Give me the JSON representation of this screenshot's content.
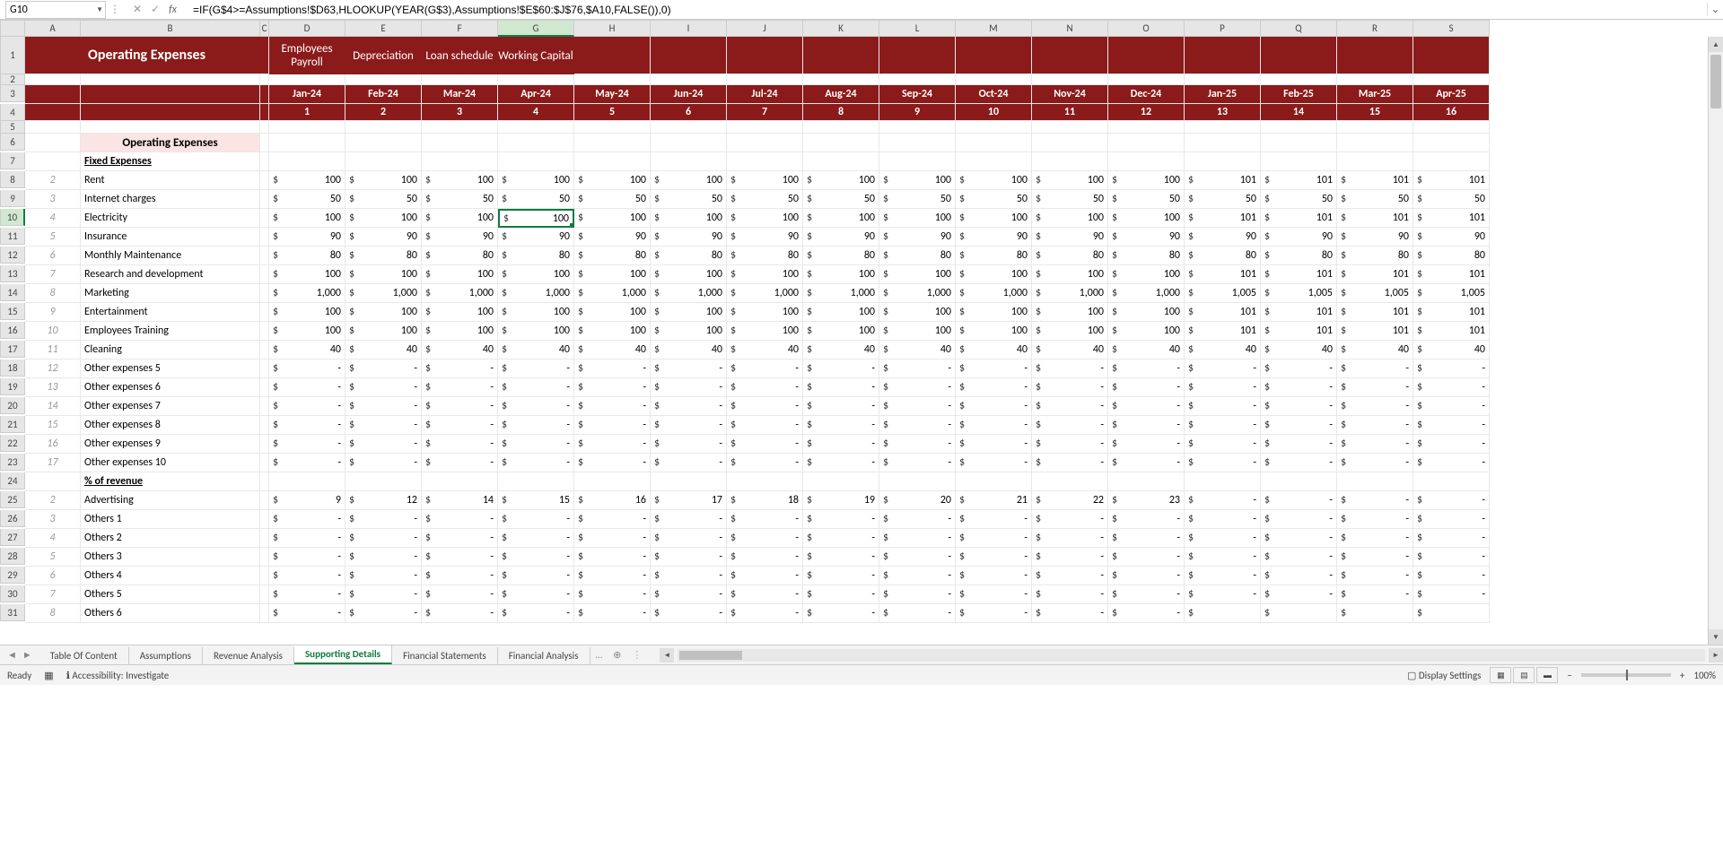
{
  "name_box": "G10",
  "formula": "=IF(G$4>=Assumptions!$D63,HLOOKUP(YEAR(G$3),Assumptions!$E$60:$J$76,$A10,FALSE()),0)",
  "title": "Operating Expenses",
  "top_tabs": {
    "D": "Employees Payroll",
    "E": "Depreciation",
    "F": "Loan schedule",
    "G": "Working Capital"
  },
  "columns": [
    "A",
    "B",
    "C",
    "D",
    "E",
    "F",
    "G",
    "H",
    "I",
    "J",
    "K",
    "L",
    "M",
    "N",
    "O",
    "P",
    "Q",
    "R",
    "S"
  ],
  "months": [
    "Jan-24",
    "Feb-24",
    "Mar-24",
    "Apr-24",
    "May-24",
    "Jun-24",
    "Jul-24",
    "Aug-24",
    "Sep-24",
    "Oct-24",
    "Nov-24",
    "Dec-24",
    "Jan-25",
    "Feb-25",
    "Mar-25",
    "Apr-25"
  ],
  "month_idx": [
    "1",
    "2",
    "3",
    "4",
    "5",
    "6",
    "7",
    "8",
    "9",
    "10",
    "11",
    "12",
    "13",
    "14",
    "15",
    "16"
  ],
  "section_header": "Operating Expenses",
  "fixed_header": "Fixed Expenses",
  "pct_header": "% of revenue",
  "fixed_rows": [
    {
      "idx": "2",
      "label": "Rent",
      "vals": [
        "100",
        "100",
        "100",
        "100",
        "100",
        "100",
        "100",
        "100",
        "100",
        "100",
        "100",
        "100",
        "101",
        "101",
        "101",
        "101"
      ]
    },
    {
      "idx": "3",
      "label": "Internet charges",
      "vals": [
        "50",
        "50",
        "50",
        "50",
        "50",
        "50",
        "50",
        "50",
        "50",
        "50",
        "50",
        "50",
        "50",
        "50",
        "50",
        "50"
      ]
    },
    {
      "idx": "4",
      "label": "Electricity",
      "vals": [
        "100",
        "100",
        "100",
        "100",
        "100",
        "100",
        "100",
        "100",
        "100",
        "100",
        "100",
        "100",
        "101",
        "101",
        "101",
        "101"
      ]
    },
    {
      "idx": "5",
      "label": "Insurance",
      "vals": [
        "90",
        "90",
        "90",
        "90",
        "90",
        "90",
        "90",
        "90",
        "90",
        "90",
        "90",
        "90",
        "90",
        "90",
        "90",
        "90"
      ]
    },
    {
      "idx": "6",
      "label": "Monthly Maintenance",
      "vals": [
        "80",
        "80",
        "80",
        "80",
        "80",
        "80",
        "80",
        "80",
        "80",
        "80",
        "80",
        "80",
        "80",
        "80",
        "80",
        "80"
      ]
    },
    {
      "idx": "7",
      "label": "Research and development",
      "vals": [
        "100",
        "100",
        "100",
        "100",
        "100",
        "100",
        "100",
        "100",
        "100",
        "100",
        "100",
        "100",
        "101",
        "101",
        "101",
        "101"
      ]
    },
    {
      "idx": "8",
      "label": "Marketing",
      "vals": [
        "1,000",
        "1,000",
        "1,000",
        "1,000",
        "1,000",
        "1,000",
        "1,000",
        "1,000",
        "1,000",
        "1,000",
        "1,000",
        "1,000",
        "1,005",
        "1,005",
        "1,005",
        "1,005"
      ]
    },
    {
      "idx": "9",
      "label": "Entertainment",
      "vals": [
        "100",
        "100",
        "100",
        "100",
        "100",
        "100",
        "100",
        "100",
        "100",
        "100",
        "100",
        "100",
        "101",
        "101",
        "101",
        "101"
      ]
    },
    {
      "idx": "10",
      "label": "Employees Training",
      "vals": [
        "100",
        "100",
        "100",
        "100",
        "100",
        "100",
        "100",
        "100",
        "100",
        "100",
        "100",
        "100",
        "101",
        "101",
        "101",
        "101"
      ]
    },
    {
      "idx": "11",
      "label": "Cleaning",
      "vals": [
        "40",
        "40",
        "40",
        "40",
        "40",
        "40",
        "40",
        "40",
        "40",
        "40",
        "40",
        "40",
        "40",
        "40",
        "40",
        "40"
      ]
    },
    {
      "idx": "12",
      "label": "Other expenses 5",
      "vals": [
        "-",
        "-",
        "-",
        "-",
        "-",
        "-",
        "-",
        "-",
        "-",
        "-",
        "-",
        "-",
        "-",
        "-",
        "-",
        "-"
      ]
    },
    {
      "idx": "13",
      "label": "Other expenses 6",
      "vals": [
        "-",
        "-",
        "-",
        "-",
        "-",
        "-",
        "-",
        "-",
        "-",
        "-",
        "-",
        "-",
        "-",
        "-",
        "-",
        "-"
      ]
    },
    {
      "idx": "14",
      "label": "Other expenses 7",
      "vals": [
        "-",
        "-",
        "-",
        "-",
        "-",
        "-",
        "-",
        "-",
        "-",
        "-",
        "-",
        "-",
        "-",
        "-",
        "-",
        "-"
      ]
    },
    {
      "idx": "15",
      "label": "Other expenses 8",
      "vals": [
        "-",
        "-",
        "-",
        "-",
        "-",
        "-",
        "-",
        "-",
        "-",
        "-",
        "-",
        "-",
        "-",
        "-",
        "-",
        "-"
      ]
    },
    {
      "idx": "16",
      "label": "Other expenses 9",
      "vals": [
        "-",
        "-",
        "-",
        "-",
        "-",
        "-",
        "-",
        "-",
        "-",
        "-",
        "-",
        "-",
        "-",
        "-",
        "-",
        "-"
      ]
    },
    {
      "idx": "17",
      "label": "Other expenses 10",
      "vals": [
        "-",
        "-",
        "-",
        "-",
        "-",
        "-",
        "-",
        "-",
        "-",
        "-",
        "-",
        "-",
        "-",
        "-",
        "-",
        "-"
      ]
    }
  ],
  "pct_rows": [
    {
      "idx": "2",
      "label": "Advertising",
      "vals": [
        "9",
        "12",
        "14",
        "15",
        "16",
        "17",
        "18",
        "19",
        "20",
        "21",
        "22",
        "23",
        "-",
        "-",
        "-",
        "-"
      ]
    },
    {
      "idx": "3",
      "label": "Others 1",
      "vals": [
        "-",
        "-",
        "-",
        "-",
        "-",
        "-",
        "-",
        "-",
        "-",
        "-",
        "-",
        "-",
        "-",
        "-",
        "-",
        "-"
      ]
    },
    {
      "idx": "4",
      "label": "Others 2",
      "vals": [
        "-",
        "-",
        "-",
        "-",
        "-",
        "-",
        "-",
        "-",
        "-",
        "-",
        "-",
        "-",
        "-",
        "-",
        "-",
        "-"
      ]
    },
    {
      "idx": "5",
      "label": "Others 3",
      "vals": [
        "-",
        "-",
        "-",
        "-",
        "-",
        "-",
        "-",
        "-",
        "-",
        "-",
        "-",
        "-",
        "-",
        "-",
        "-",
        "-"
      ]
    },
    {
      "idx": "6",
      "label": "Others 4",
      "vals": [
        "-",
        "-",
        "-",
        "-",
        "-",
        "-",
        "-",
        "-",
        "-",
        "-",
        "-",
        "-",
        "-",
        "-",
        "-",
        "-"
      ]
    },
    {
      "idx": "7",
      "label": "Others 5",
      "vals": [
        "-",
        "-",
        "-",
        "-",
        "-",
        "-",
        "-",
        "-",
        "-",
        "-",
        "-",
        "-",
        "-",
        "-",
        "-",
        "-"
      ]
    },
    {
      "idx": "8",
      "label": "Others 6",
      "vals": [
        "-",
        "-",
        "-",
        "-",
        "-",
        "-",
        "-",
        "-",
        "-",
        "-",
        "-",
        "-",
        "",
        "",
        "",
        ""
      ]
    }
  ],
  "sheets": [
    "Table Of Content",
    "Assumptions",
    "Revenue Analysis",
    "Supporting Details",
    "Financial Statements",
    "Financial Analysis"
  ],
  "active_sheet": "Supporting Details",
  "status": {
    "ready": "Ready",
    "accessibility": "Accessibility: Investigate",
    "display_settings": "Display Settings",
    "zoom": "100%"
  }
}
